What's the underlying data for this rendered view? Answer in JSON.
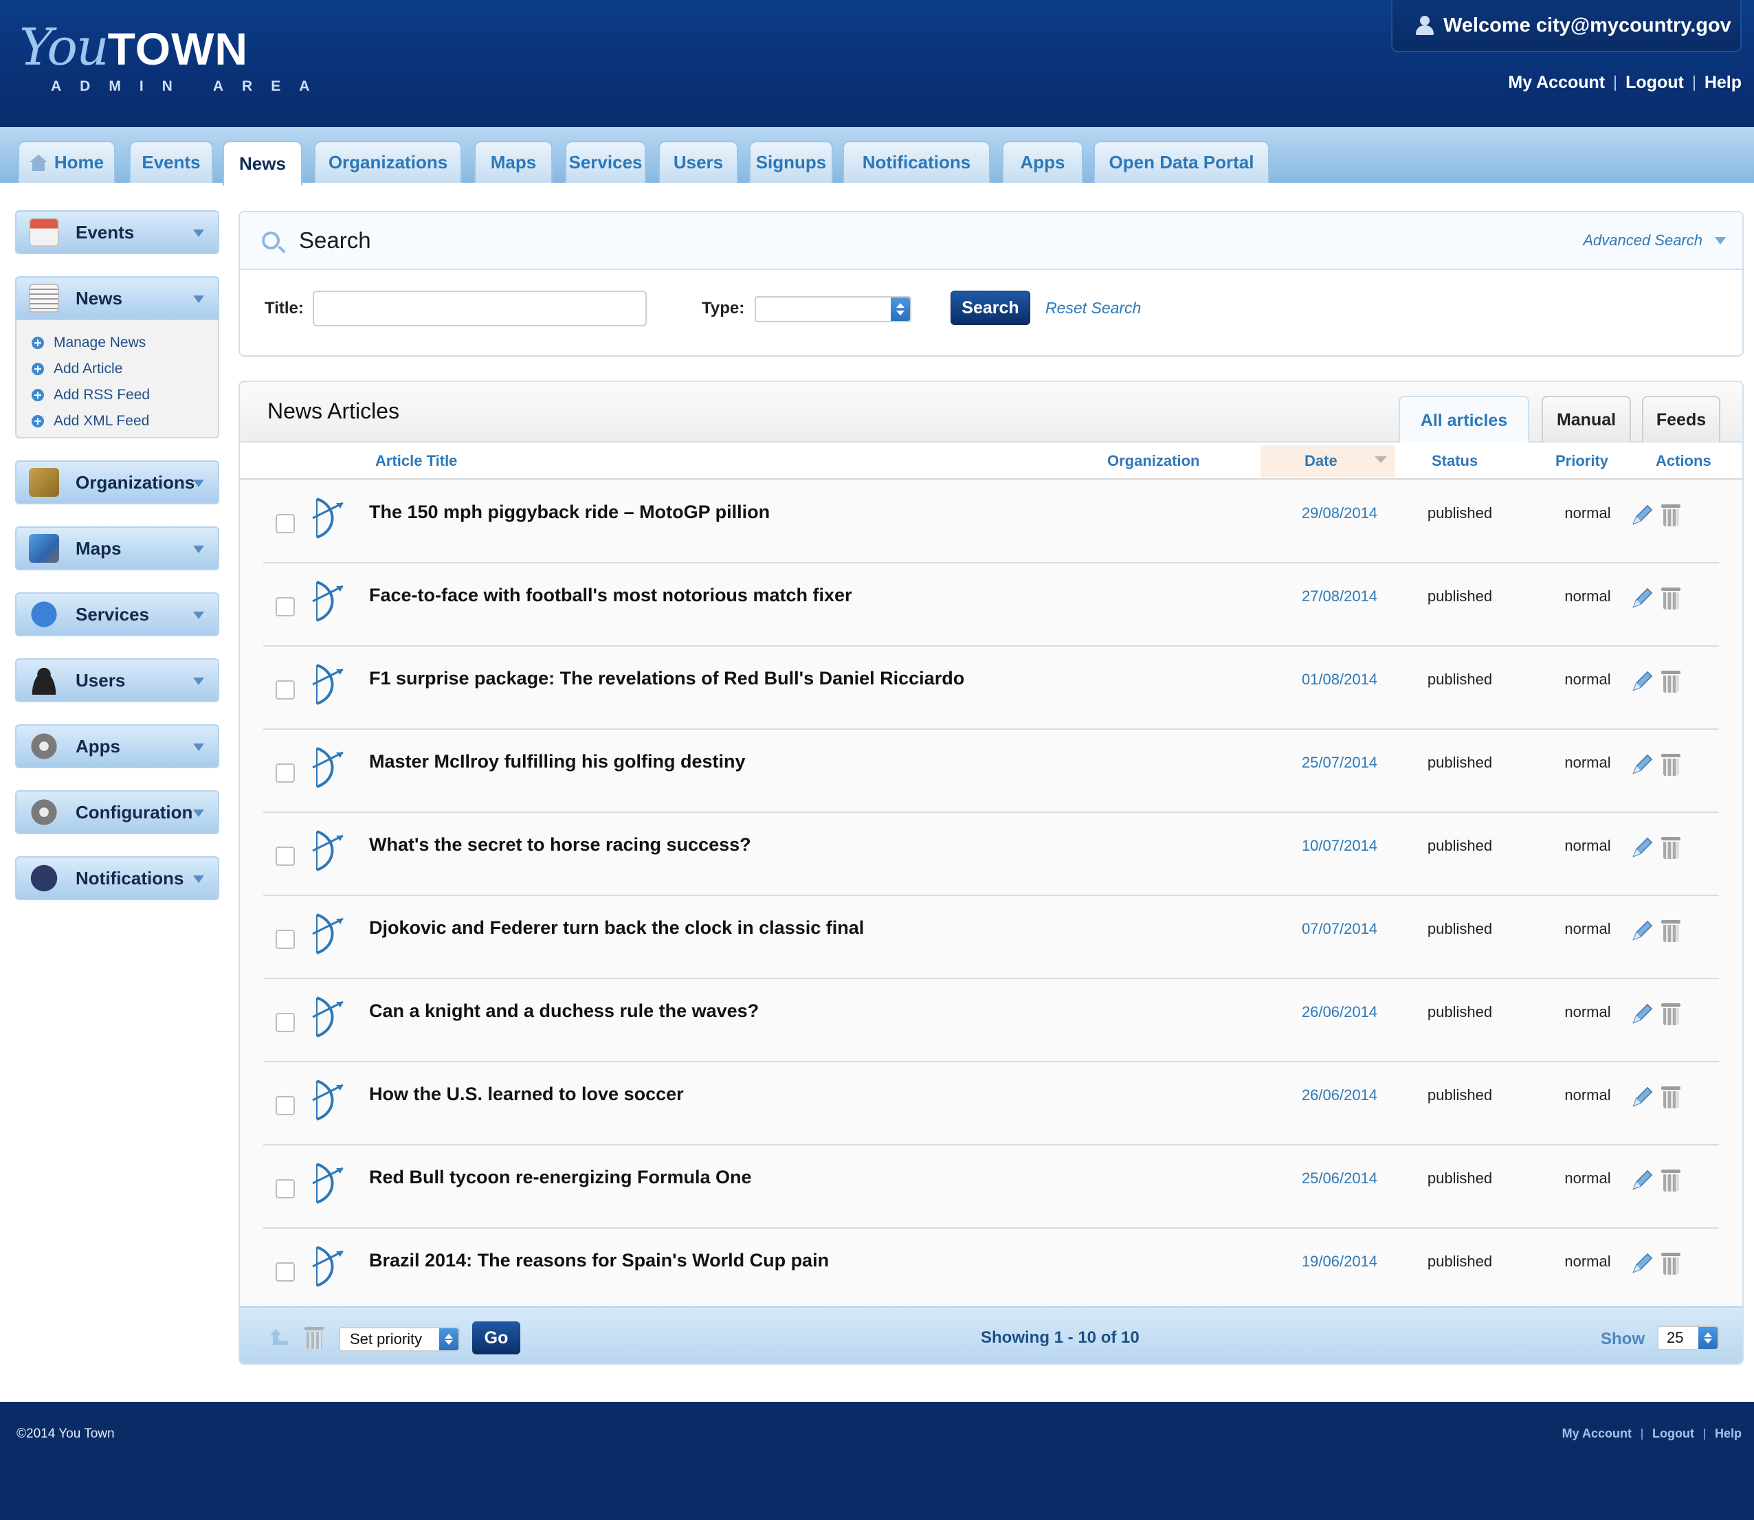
{
  "brand": {
    "logo_you": "You",
    "logo_town": "TOWN",
    "logo_sub": "ADMIN AREA"
  },
  "header": {
    "welcome": "Welcome city@mycountry.gov",
    "links": [
      "My Account",
      "Logout",
      "Help"
    ]
  },
  "tabs": [
    {
      "label": "Home",
      "icon": "home-icon",
      "active": false
    },
    {
      "label": "Events",
      "active": false
    },
    {
      "label": "News",
      "active": true
    },
    {
      "label": "Organizations",
      "active": false
    },
    {
      "label": "Maps",
      "active": false
    },
    {
      "label": "Services",
      "active": false
    },
    {
      "label": "Users",
      "active": false
    },
    {
      "label": "Signups",
      "active": false
    },
    {
      "label": "Notifications",
      "active": false
    },
    {
      "label": "Apps",
      "active": false
    },
    {
      "label": "Open Data Portal",
      "active": false
    }
  ],
  "sidebar": {
    "items": [
      {
        "label": "Events",
        "icon": "calendar-icon"
      },
      {
        "label": "News",
        "icon": "newspaper-icon",
        "expanded": true
      },
      {
        "label": "Organizations",
        "icon": "address-book-icon"
      },
      {
        "label": "Maps",
        "icon": "map-icon"
      },
      {
        "label": "Services",
        "icon": "info-icon"
      },
      {
        "label": "Users",
        "icon": "user-icon"
      },
      {
        "label": "Apps",
        "icon": "gear-icon"
      },
      {
        "label": "Configuration",
        "icon": "gear-icon"
      },
      {
        "label": "Notifications",
        "icon": "megaphone-icon"
      }
    ],
    "news_submenu": [
      "Manage News",
      "Add Article",
      "Add RSS Feed",
      "Add XML Feed"
    ]
  },
  "search": {
    "title": "Search",
    "advanced_link": "Advanced Search",
    "title_label": "Title:",
    "title_value": "",
    "type_label": "Type:",
    "type_value": "",
    "search_button": "Search",
    "reset_link": "Reset Search"
  },
  "news": {
    "panel_title": "News Articles",
    "view_tabs": [
      {
        "label": "All articles",
        "active": true
      },
      {
        "label": "Manual",
        "active": false
      },
      {
        "label": "Feeds",
        "active": false
      }
    ],
    "columns": [
      "Article Title",
      "Organization",
      "Date",
      "Status",
      "Priority",
      "Actions"
    ],
    "sorted_column": "Date",
    "articles": [
      {
        "title": "The 150 mph piggyback ride – MotoGP pillion",
        "date": "29/08/2014",
        "status": "published",
        "priority": "normal"
      },
      {
        "title": "Face-to-face with football's most notorious match fixer",
        "date": "27/08/2014",
        "status": "published",
        "priority": "normal"
      },
      {
        "title": "F1 surprise package: The revelations of Red Bull's Daniel Ricciardo",
        "date": "01/08/2014",
        "status": "published",
        "priority": "normal"
      },
      {
        "title": "Master McIlroy fulfilling his golfing destiny",
        "date": "25/07/2014",
        "status": "published",
        "priority": "normal"
      },
      {
        "title": "What's the secret to horse racing success?",
        "date": "10/07/2014",
        "status": "published",
        "priority": "normal"
      },
      {
        "title": "Djokovic and Federer turn back the clock in classic final",
        "date": "07/07/2014",
        "status": "published",
        "priority": "normal"
      },
      {
        "title": "Can a knight and a duchess rule the waves?",
        "date": "26/06/2014",
        "status": "published",
        "priority": "normal"
      },
      {
        "title": "How the U.S. learned to love soccer",
        "date": "26/06/2014",
        "status": "published",
        "priority": "normal"
      },
      {
        "title": "Red Bull tycoon re-energizing Formula One",
        "date": "25/06/2014",
        "status": "published",
        "priority": "normal"
      },
      {
        "title": "Brazil 2014: The reasons for Spain's World Cup pain",
        "date": "19/06/2014",
        "status": "published",
        "priority": "normal"
      }
    ],
    "footer": {
      "set_priority": "Set priority",
      "go_button": "Go",
      "showing": "Showing 1 - 10 of 10",
      "show_label": "Show",
      "show_value": "25"
    }
  },
  "footer": {
    "copyright": "©2014 You Town",
    "links": [
      "My Account",
      "Logout",
      "Help"
    ]
  },
  "colors": {
    "header": "#0a2c66",
    "accent": "#2d78b8",
    "button": "#0b2d66"
  }
}
